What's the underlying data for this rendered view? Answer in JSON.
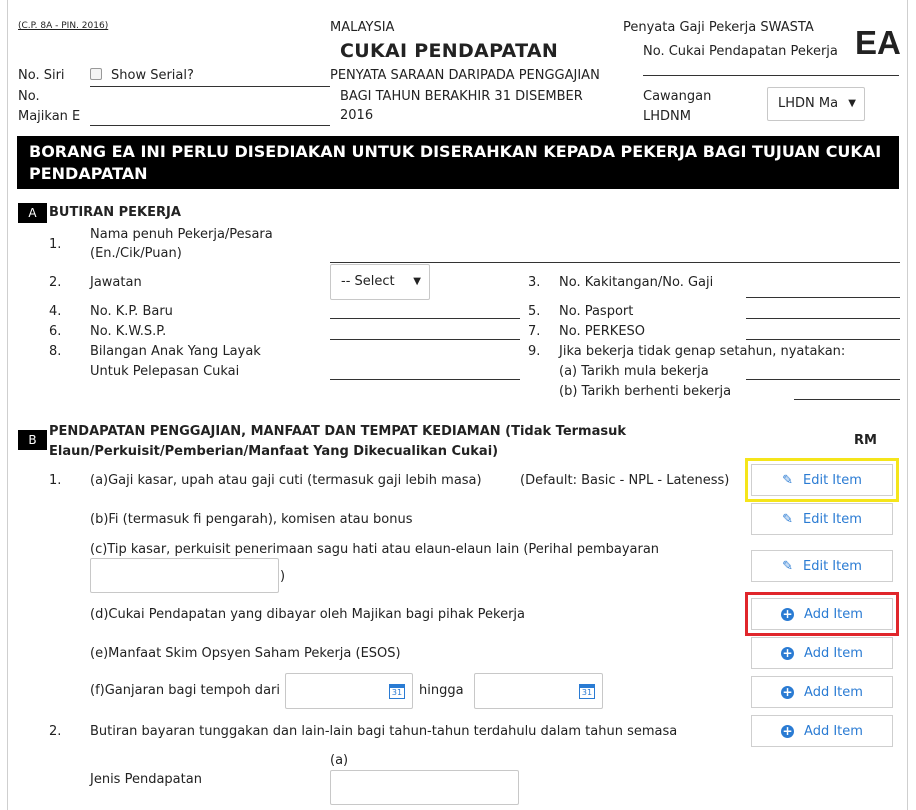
{
  "header": {
    "form_code": "(C.P. 8A - PIN. 2016)",
    "country": "MALAYSIA",
    "title": "CUKAI PENDAPATAN",
    "subtitle_line1": "PENYATA SARAAN DARIPADA PENGGAJIAN",
    "subtitle_line2": "BAGI TAHUN BERAKHIR 31 DISEMBER",
    "year": "2016",
    "statement_type": "Penyata Gaji Pekerja SWASTA",
    "tax_no_label": "No. Cukai Pendapatan Pekerja",
    "ea_label": "EA",
    "serial_no_label": "No. Siri",
    "show_serial_label": "Show Serial?",
    "employer_no_label_line1": "No.",
    "employer_no_label_line2": "Majikan E",
    "branch_label_line1": "Cawangan",
    "branch_label_line2": "LHDNM",
    "branch_select_value": "LHDN Ma"
  },
  "banner": "BORANG EA INI PERLU DISEDIAKAN UNTUK DISERAHKAN KEPADA PEKERJA BAGI TUJUAN CUKAI PENDAPATAN",
  "section_a": {
    "letter": "A",
    "title": "BUTIRAN PEKERJA",
    "f1_num": "1.",
    "f1_label_line1": "Nama penuh Pekerja/Pesara",
    "f1_label_line2": "(En./Cik/Puan)",
    "f2_num": "2.",
    "f2_label": "Jawatan",
    "f2_select": "-- Select",
    "f3_num": "3.",
    "f3_label": "No. Kakitangan/No. Gaji",
    "f4_num": "4.",
    "f4_label": "No. K.P. Baru",
    "f5_num": "5.",
    "f5_label": "No. Pasport",
    "f6_num": "6.",
    "f6_label": "No. K.W.S.P.",
    "f7_num": "7.",
    "f7_label": "No. PERKESO",
    "f8_num": "8.",
    "f8_label_line1": "Bilangan Anak Yang Layak",
    "f8_label_line2": "Untuk Pelepasan Cukai",
    "f9_num": "9.",
    "f9_label": "Jika bekerja tidak genap setahun, nyatakan:",
    "f9a": "(a)  Tarikh mula bekerja",
    "f9b": "(b)  Tarikh berhenti bekerja"
  },
  "section_b": {
    "letter": "B",
    "title_line1": "PENDAPATAN PENGGAJIAN, MANFAAT DAN TEMPAT KEDIAMAN (Tidak Termasuk",
    "title_line2": "Elaun/Perkuisit/Pemberian/Manfaat Yang Dikecualikan Cukai)",
    "rm_label": "RM",
    "item1_num": "1.",
    "item1a": "(a)Gaji kasar, upah atau gaji cuti (termasuk gaji lebih masa)",
    "item1a_default": "(Default: Basic - NPL - Lateness)",
    "item1b": "(b)Fi (termasuk fi pengarah), komisen atau bonus",
    "item1c": "(c)Tip kasar, perkuisit penerimaan sagu hati atau elaun-elaun lain (Perihal pembayaran",
    "item1c_close": ")",
    "item1d": "(d)Cukai Pendapatan yang dibayar oleh Majikan bagi pihak Pekerja",
    "item1e": "(e)Manfaat Skim Opsyen Saham Pekerja (ESOS)",
    "item1f": "(f)Ganjaran bagi tempoh dari",
    "item1f_to": "hingga",
    "item2_num": "2.",
    "item2": "Butiran bayaran tunggakan dan lain-lain bagi tahun-tahun terdahulu dalam tahun semasa",
    "item2_sub": "(a)",
    "item2_income_type": "Jenis Pendapatan",
    "edit_label": "Edit Item",
    "add_label": "Add Item",
    "calendar_day": "31"
  },
  "colors": {
    "accent": "#2a7bd3",
    "highlight_yellow": "#f5e51a",
    "highlight_red": "#e0262b"
  }
}
